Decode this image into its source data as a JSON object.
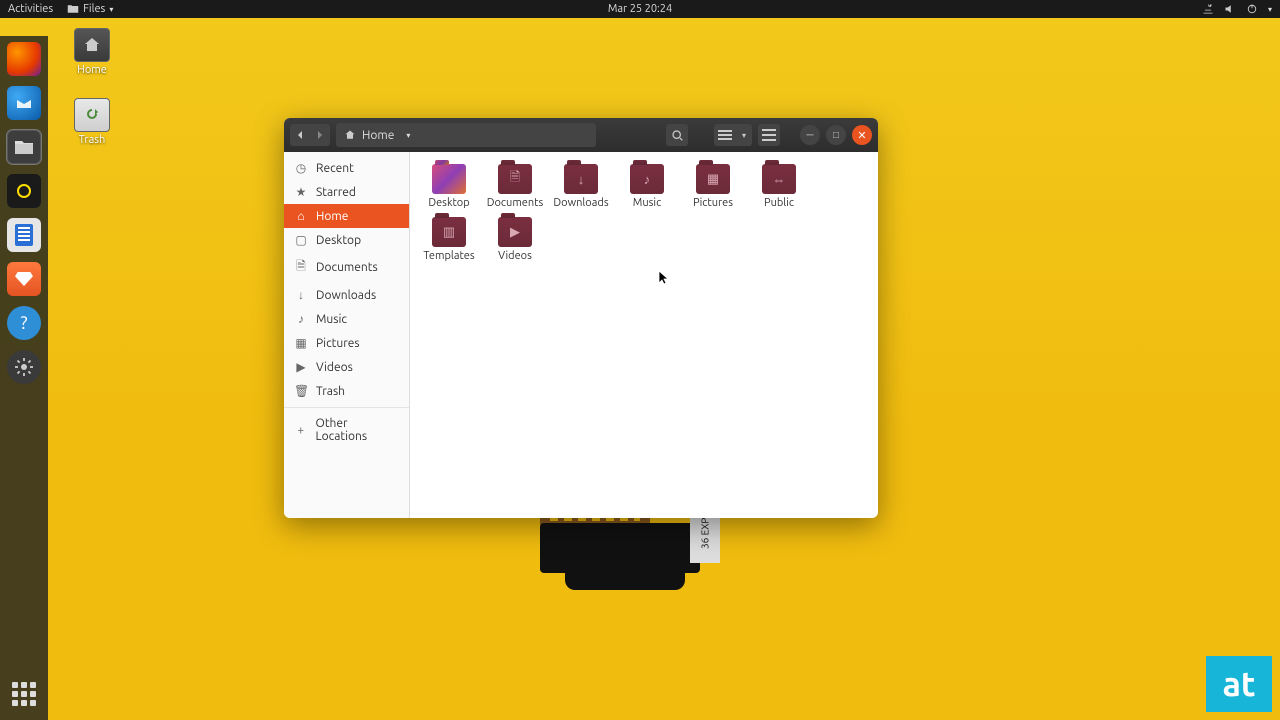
{
  "topbar": {
    "activities": "Activities",
    "app_label": "Files",
    "datetime": "Mar 25  20:24"
  },
  "desktop_icons": {
    "home": "Home",
    "trash": "Trash"
  },
  "at_badge": "at",
  "wallpaper_label": "36 EXP",
  "window": {
    "path_label": "Home",
    "sidebar": {
      "recent": "Recent",
      "starred": "Starred",
      "home": "Home",
      "desktop": "Desktop",
      "documents": "Documents",
      "downloads": "Downloads",
      "music": "Music",
      "pictures": "Pictures",
      "videos": "Videos",
      "trash": "Trash",
      "other": "Other Locations"
    },
    "folders": {
      "desktop": "Desktop",
      "documents": "Documents",
      "downloads": "Downloads",
      "music": "Music",
      "pictures": "Pictures",
      "public": "Public",
      "templates": "Templates",
      "videos": "Videos"
    }
  }
}
